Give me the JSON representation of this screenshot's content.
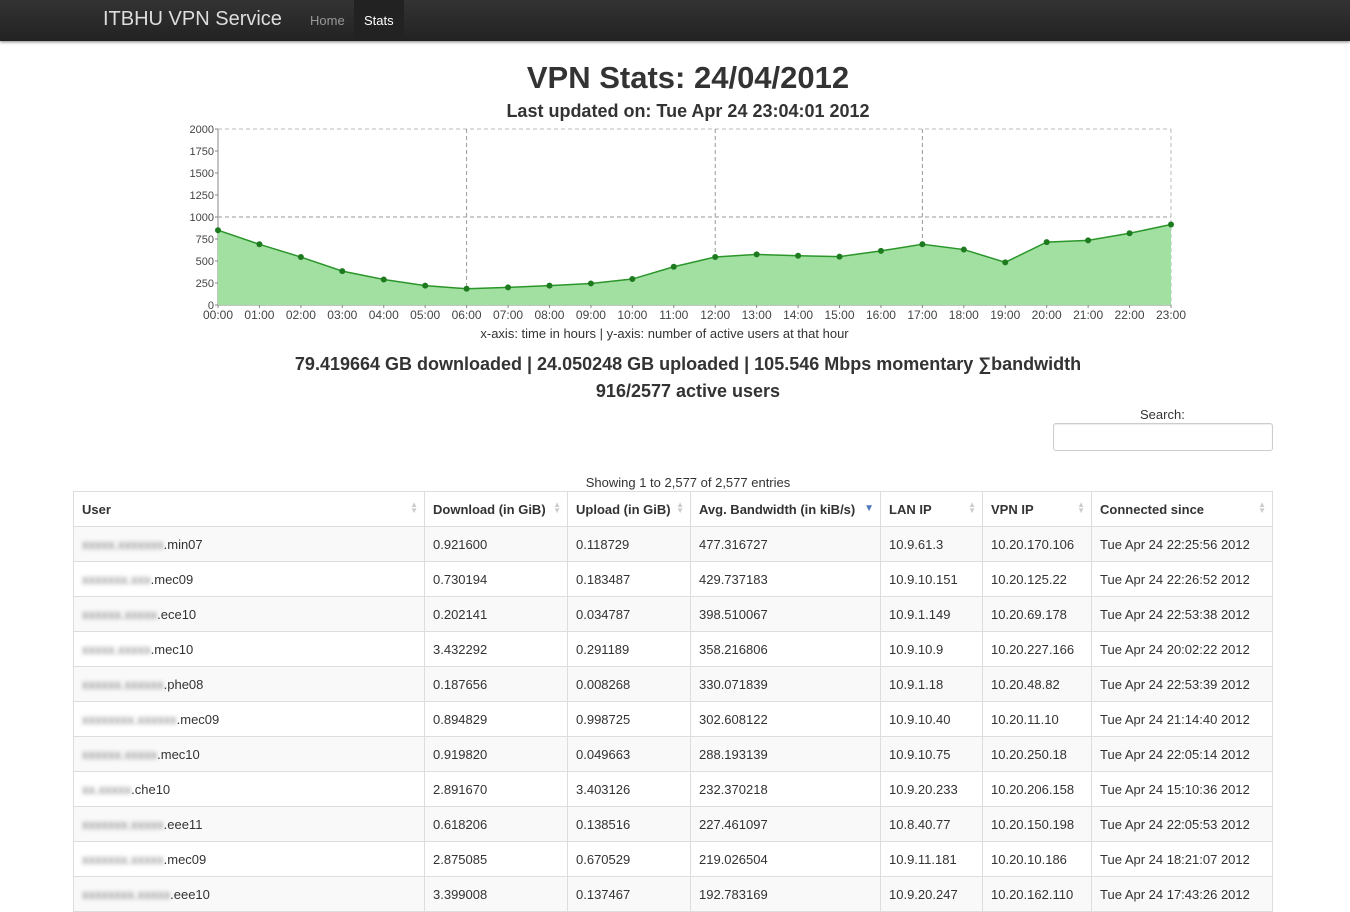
{
  "nav": {
    "brand": "ITBHU VPN Service",
    "items": [
      "Home",
      "Stats"
    ]
  },
  "header": {
    "title": "VPN Stats: 24/04/2012",
    "subtitle": "Last updated on: Tue Apr 24 23:04:01 2012"
  },
  "chart_data": {
    "type": "area",
    "x": [
      "00:00",
      "01:00",
      "02:00",
      "03:00",
      "04:00",
      "05:00",
      "06:00",
      "07:00",
      "08:00",
      "09:00",
      "10:00",
      "11:00",
      "12:00",
      "13:00",
      "14:00",
      "15:00",
      "16:00",
      "17:00",
      "18:00",
      "19:00",
      "20:00",
      "21:00",
      "22:00",
      "23:00"
    ],
    "values": [
      850,
      690,
      545,
      385,
      290,
      220,
      185,
      200,
      220,
      245,
      295,
      435,
      545,
      575,
      560,
      550,
      615,
      690,
      630,
      485,
      715,
      735,
      815,
      915
    ],
    "yticks": [
      0,
      250,
      500,
      750,
      1000,
      1250,
      1500,
      1750,
      2000
    ],
    "ylim": [
      0,
      2000
    ],
    "caption": "x-axis: time in hours | y-axis: number of active users at that hour",
    "fill": "#a2e0a2",
    "line": "#2a962a",
    "grid": true
  },
  "summary": {
    "line1": "79.419664 GB downloaded | 24.050248 GB uploaded | 105.546 Mbps momentary ∑bandwidth",
    "line2": "916/2577 active users"
  },
  "search": {
    "label": "Search:",
    "value": ""
  },
  "table": {
    "info": "Showing 1 to 2,577 of 2,577 entries",
    "columns": [
      "User",
      "Download (in GiB)",
      "Upload (in GiB)",
      "Avg. Bandwidth (in kiB/s)",
      "LAN IP",
      "VPN IP",
      "Connected since"
    ],
    "rows": [
      {
        "user_suffix": ".min07",
        "download": "0.921600",
        "upload": "0.118729",
        "bandwidth": "477.316727",
        "lan": "10.9.61.3",
        "vpn": "10.20.170.106",
        "since": "Tue Apr 24 22:25:56 2012"
      },
      {
        "user_suffix": ".mec09",
        "download": "0.730194",
        "upload": "0.183487",
        "bandwidth": "429.737183",
        "lan": "10.9.10.151",
        "vpn": "10.20.125.22",
        "since": "Tue Apr 24 22:26:52 2012"
      },
      {
        "user_suffix": ".ece10",
        "download": "0.202141",
        "upload": "0.034787",
        "bandwidth": "398.510067",
        "lan": "10.9.1.149",
        "vpn": "10.20.69.178",
        "since": "Tue Apr 24 22:53:38 2012"
      },
      {
        "user_suffix": ".mec10",
        "download": "3.432292",
        "upload": "0.291189",
        "bandwidth": "358.216806",
        "lan": "10.9.10.9",
        "vpn": "10.20.227.166",
        "since": "Tue Apr 24 20:02:22 2012"
      },
      {
        "user_suffix": ".phe08",
        "download": "0.187656",
        "upload": "0.008268",
        "bandwidth": "330.071839",
        "lan": "10.9.1.18",
        "vpn": "10.20.48.82",
        "since": "Tue Apr 24 22:53:39 2012"
      },
      {
        "user_suffix": ".mec09",
        "download": "0.894829",
        "upload": "0.998725",
        "bandwidth": "302.608122",
        "lan": "10.9.10.40",
        "vpn": "10.20.11.10",
        "since": "Tue Apr 24 21:14:40 2012"
      },
      {
        "user_suffix": ".mec10",
        "download": "0.919820",
        "upload": "0.049663",
        "bandwidth": "288.193139",
        "lan": "10.9.10.75",
        "vpn": "10.20.250.18",
        "since": "Tue Apr 24 22:05:14 2012"
      },
      {
        "user_suffix": ".che10",
        "download": "2.891670",
        "upload": "3.403126",
        "bandwidth": "232.370218",
        "lan": "10.9.20.233",
        "vpn": "10.20.206.158",
        "since": "Tue Apr 24 15:10:36 2012"
      },
      {
        "user_suffix": ".eee11",
        "download": "0.618206",
        "upload": "0.138516",
        "bandwidth": "227.461097",
        "lan": "10.8.40.77",
        "vpn": "10.20.150.198",
        "since": "Tue Apr 24 22:05:53 2012"
      },
      {
        "user_suffix": ".mec09",
        "download": "2.875085",
        "upload": "0.670529",
        "bandwidth": "219.026504",
        "lan": "10.9.11.181",
        "vpn": "10.20.10.186",
        "since": "Tue Apr 24 18:21:07 2012"
      },
      {
        "user_suffix": ".eee10",
        "download": "3.399008",
        "upload": "0.137467",
        "bandwidth": "192.783169",
        "lan": "10.9.20.247",
        "vpn": "10.20.162.110",
        "since": "Tue Apr 24 17:43:26 2012"
      }
    ]
  }
}
